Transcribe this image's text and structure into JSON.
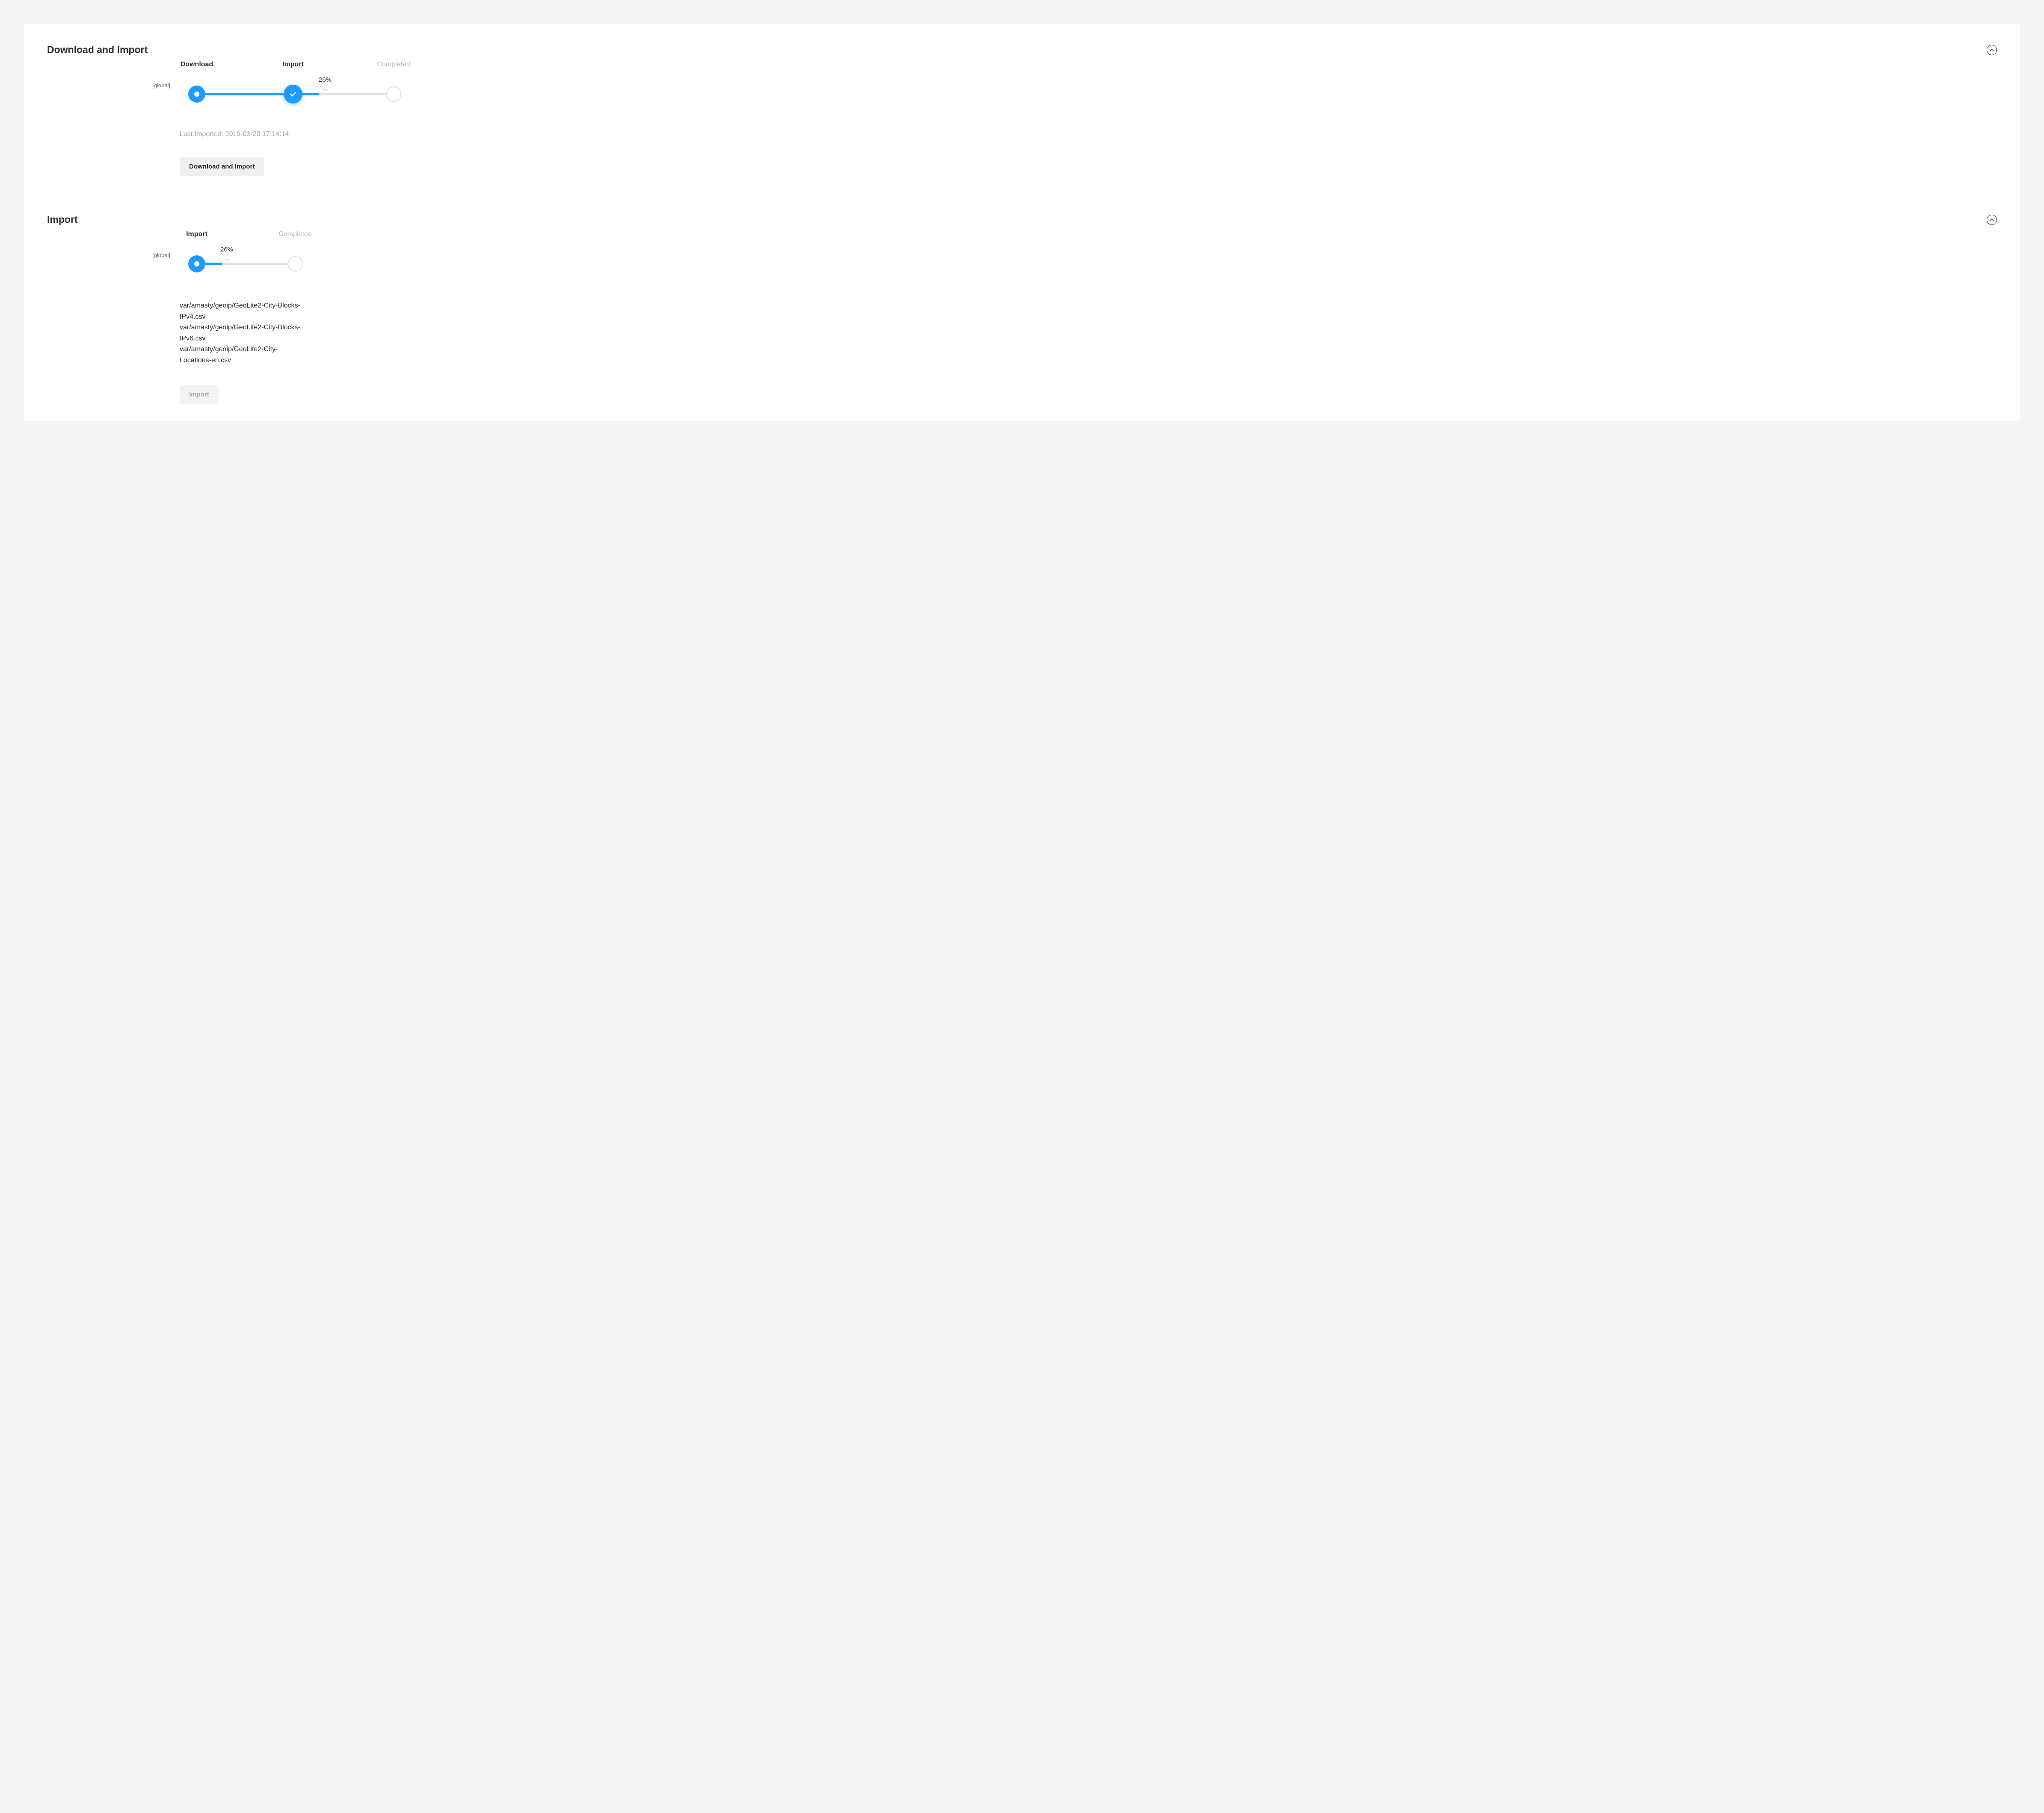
{
  "colors": {
    "accent": "#1f9bff",
    "muted": "#b8b8b8",
    "track": "#e0e0e0"
  },
  "section1": {
    "title": "Download and Import",
    "scope": "[global]",
    "steps": {
      "download": "Download",
      "import": "Import",
      "completed": "Completed"
    },
    "progress_percent": "26%",
    "progress_value": 26,
    "last_imported_label": "Last Imported:",
    "last_imported_value": "2019-03-20 17:14:14",
    "button": "Download and Import"
  },
  "section2": {
    "title": "Import",
    "scope": "[global]",
    "steps": {
      "import": "Import",
      "completed": "Completed"
    },
    "progress_percent": "26%",
    "progress_value": 26,
    "files": [
      "var/amasty/geoip/GeoLite2-City-Blocks-IPv4.csv",
      "var/amasty/geoip/GeoLite2-City-Blocks-IPv6.csv",
      "var/amasty/geoip/GeoLite2-City-Locations-en.csv"
    ],
    "button": "Import"
  }
}
